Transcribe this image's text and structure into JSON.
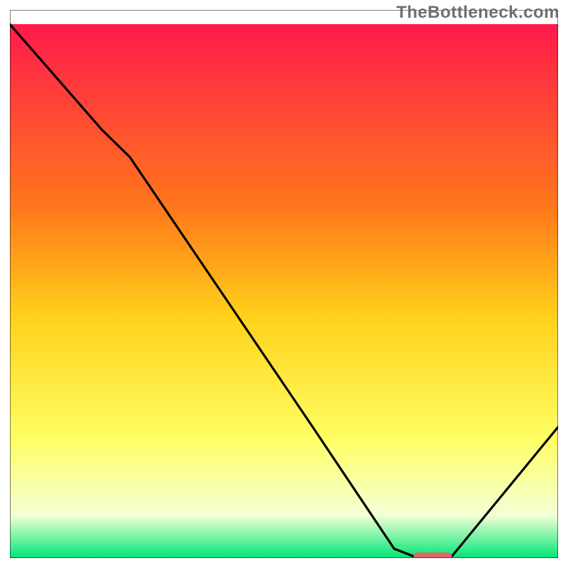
{
  "watermark": "TheBottleneck.com",
  "colors": {
    "gradient_top": "#ff1a4b",
    "gradient_mid_upper": "#ff7a1a",
    "gradient_mid": "#ffd21a",
    "gradient_mid_lower": "#ffff66",
    "gradient_lower": "#f4ffd6",
    "gradient_bottom": "#00e676",
    "curve": "#000000",
    "marker": "#e06666",
    "frame": "#000000"
  },
  "chart_data": {
    "type": "line",
    "title": "",
    "xlabel": "",
    "ylabel": "",
    "xlim": [
      0,
      100
    ],
    "ylim": [
      0,
      100
    ],
    "grid": false,
    "legend": false,
    "x": [
      0,
      17,
      22,
      55,
      70,
      75,
      80,
      100
    ],
    "values": [
      100,
      80,
      75,
      25,
      2,
      0,
      0,
      25
    ],
    "marker": {
      "x": 77,
      "y": 0.5,
      "width": 7,
      "height": 2
    },
    "note": "values are percentages of plot height; 0 = bottom (green), 100 = top (red)"
  }
}
